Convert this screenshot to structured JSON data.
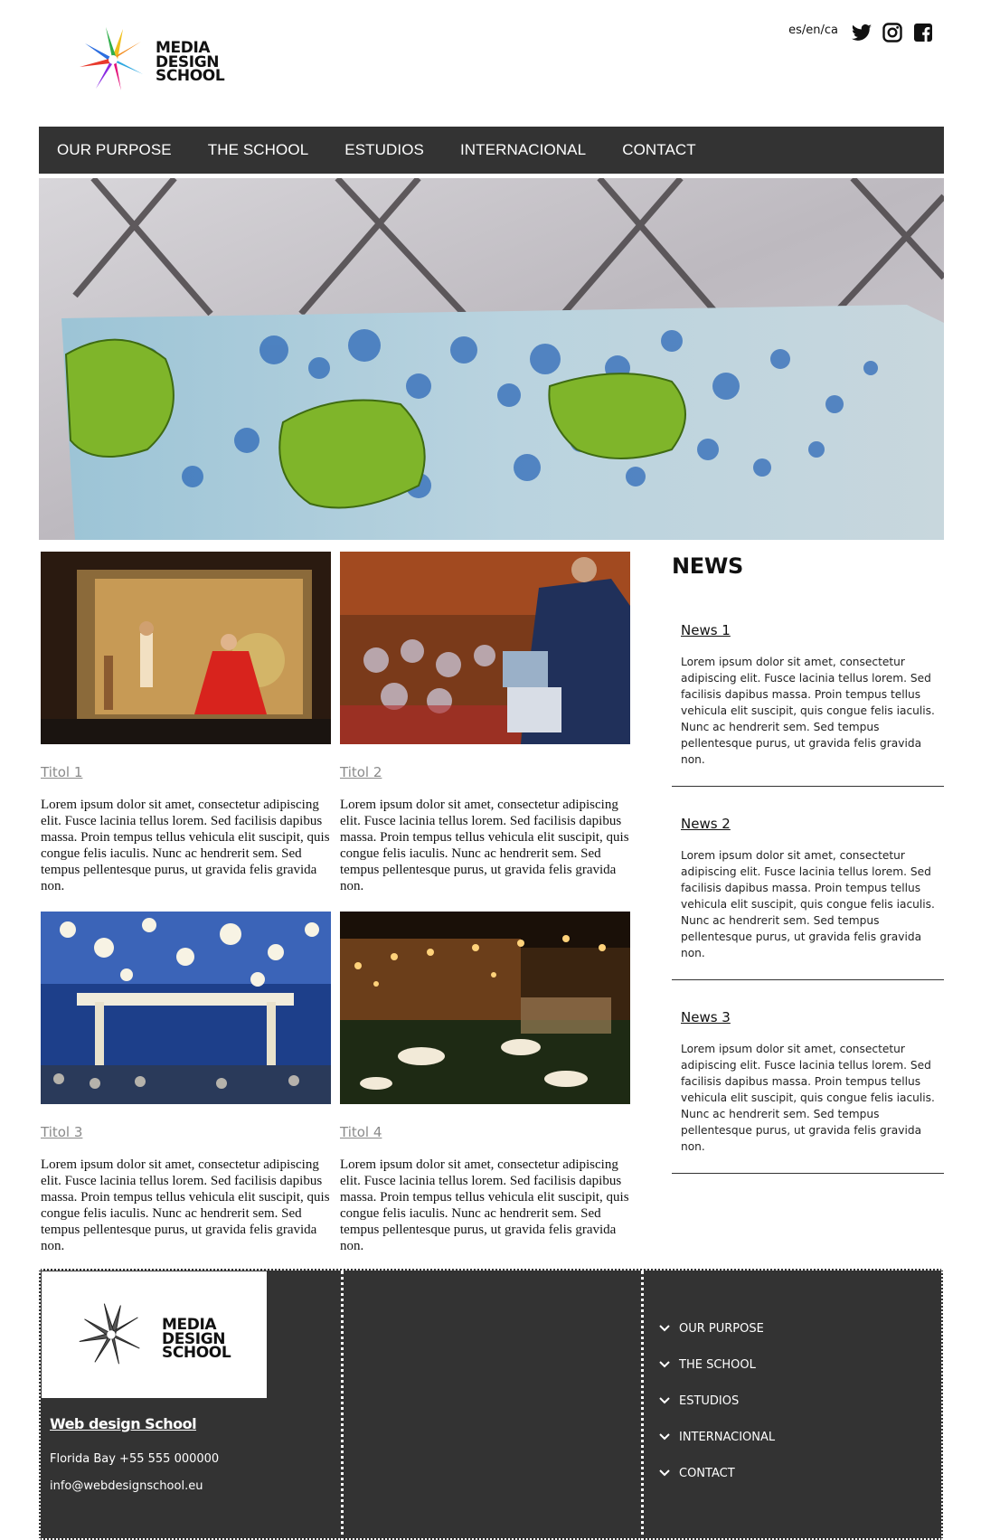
{
  "brand": {
    "logo_lines": [
      "MEDIA",
      "DESIGN",
      "SCHOOL"
    ],
    "logo_colors": [
      "#f0c020",
      "#e8392c",
      "#e3127a",
      "#8a2be2",
      "#2d6fe0",
      "#2fae4a",
      "#f28c1e"
    ]
  },
  "header": {
    "languages": "es/en/ca",
    "social": [
      "twitter-icon",
      "instagram-icon",
      "facebook-icon"
    ]
  },
  "nav": {
    "items": [
      "OUR PURPOSE",
      "THE SCHOOL",
      "ESTUDIOS",
      "INTERNACIONAL",
      "CONTACT"
    ]
  },
  "posts": [
    {
      "title": "Titol 1",
      "text": "Lorem ipsum dolor sit amet, consectetur adipiscing elit. Fusce lacinia tellus lorem. Sed facilisis dapibus massa. Proin tempus tellus vehicula elit suscipit, quis congue felis iaculis. Nunc ac hendrerit sem. Sed tempus pellentesque purus, ut gravida felis gravida non."
    },
    {
      "title": "Titol 2",
      "text": "Lorem ipsum dolor sit amet, consectetur adipiscing elit. Fusce lacinia tellus lorem. Sed facilisis dapibus massa. Proin tempus tellus vehicula elit suscipit, quis congue felis iaculis. Nunc ac hendrerit sem. Sed tempus pellentesque purus, ut gravida felis gravida non."
    },
    {
      "title": "Titol 3",
      "text": "Lorem ipsum dolor sit amet, consectetur adipiscing elit. Fusce lacinia tellus lorem. Sed facilisis dapibus massa. Proin tempus tellus vehicula elit suscipit, quis congue felis iaculis. Nunc ac hendrerit sem. Sed tempus pellentesque purus, ut gravida felis gravida non."
    },
    {
      "title": "Titol 4",
      "text": "Lorem ipsum dolor sit amet, consectetur adipiscing elit. Fusce lacinia tellus lorem. Sed facilisis dapibus massa. Proin tempus tellus vehicula elit suscipit, quis congue felis iaculis. Nunc ac hendrerit sem. Sed tempus pellentesque purus, ut gravida felis gravida non."
    }
  ],
  "news": {
    "heading": "NEWS",
    "items": [
      {
        "title": "News 1",
        "text": "Lorem ipsum dolor sit amet, consectetur adipiscing elit. Fusce lacinia tellus lorem. Sed facilisis dapibus massa. Proin tempus tellus vehicula elit suscipit, quis congue felis iaculis. Nunc ac hendrerit sem. Sed tempus pellentesque purus, ut gravida felis gravida non."
      },
      {
        "title": "News 2",
        "text": "Lorem ipsum dolor sit amet, consectetur adipiscing elit. Fusce lacinia tellus lorem. Sed facilisis dapibus massa. Proin tempus tellus vehicula elit suscipit, quis congue felis iaculis. Nunc ac hendrerit sem. Sed tempus pellentesque purus, ut gravida felis gravida non."
      },
      {
        "title": "News 3",
        "text": "Lorem ipsum dolor sit amet, consectetur adipiscing elit. Fusce lacinia tellus lorem. Sed facilisis dapibus massa. Proin tempus tellus vehicula elit suscipit, quis congue felis iaculis. Nunc ac hendrerit sem. Sed tempus pellentesque purus, ut gravida felis gravida non."
      }
    ]
  },
  "footer": {
    "logo_lines": [
      "MEDIA",
      "DESIGN",
      "SCHOOL"
    ],
    "school_link": "Web design School",
    "address": "Florida Bay +55 555 000000",
    "email": "info@webdesignschool.eu",
    "menu": [
      "OUR PURPOSE",
      "THE SCHOOL",
      "ESTUDIOS",
      "INTERNACIONAL",
      "CONTACT"
    ]
  },
  "colors": {
    "nav_bg": "#333333",
    "footer_bg": "#333333",
    "post_title": "#8a8a8a"
  }
}
